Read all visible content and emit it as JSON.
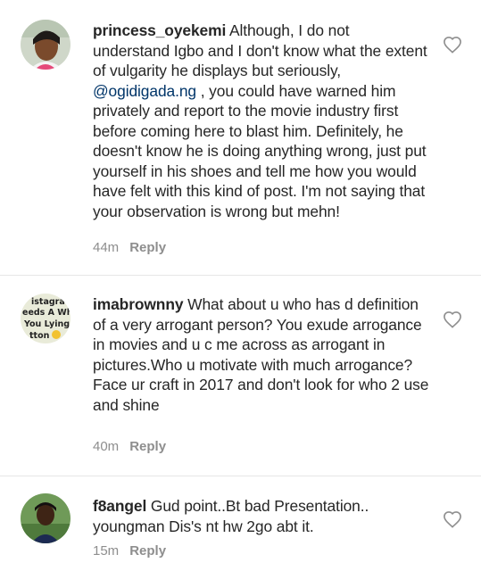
{
  "comments": [
    {
      "username": "princess_oyekemi",
      "text_before": " Although, I do not understand Igbo and I don't know what the extent of vulgarity he displays but seriously, ",
      "mention": "@ogidigada.ng",
      "text_after": " , you could have warned him privately and report to the movie industry first before coming here to blast him. Definitely, he doesn't know he is doing anything wrong, just put yourself in his shoes and tell me how you would have felt with this kind of post. I'm not saying that your observation is wrong but mehn!",
      "time": "44m",
      "reply_label": "Reply",
      "like_icon": "heart-outline-icon"
    },
    {
      "username": "imabrownny",
      "text": " What about u who has d definition of a very arrogant person? You exude arrogance in movies and u c me across as arrogant in pictures.Who u motivate with much arrogance? Face ur craft in 2017 and don't look for who 2 use and shine",
      "avatar_text": [
        "istagra",
        "eeds A Wh",
        "You Lying",
        "tton"
      ],
      "time": "40m",
      "reply_label": "Reply",
      "like_icon": "heart-outline-icon"
    },
    {
      "username": "f8angel",
      "text": " Gud point..Bt bad Presentation.. youngman Dis's nt hw 2go abt it.",
      "time": "15m",
      "reply_label": "Reply",
      "like_icon": "heart-outline-icon"
    }
  ],
  "colors": {
    "text": "#262626",
    "meta": "#8e8e8e",
    "mention": "#003569",
    "divider": "#e6e6e6"
  }
}
